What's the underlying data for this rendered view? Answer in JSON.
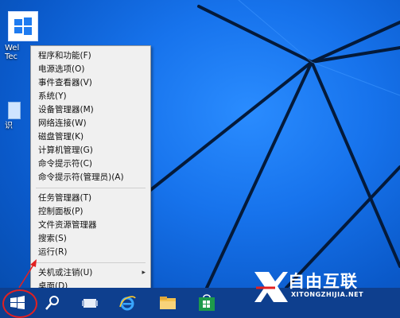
{
  "desktop": {
    "icons": [
      {
        "label": "Wel\nTec",
        "name": "welcome-tech-icon"
      },
      {
        "label": "识",
        "name": "recycle-or-app-icon"
      }
    ]
  },
  "context_menu": {
    "groups": [
      [
        "程序和功能(F)",
        "电源选项(O)",
        "事件查看器(V)",
        "系统(Y)",
        "设备管理器(M)",
        "网络连接(W)",
        "磁盘管理(K)",
        "计算机管理(G)",
        "命令提示符(C)",
        "命令提示符(管理员)(A)"
      ],
      [
        "任务管理器(T)",
        "控制面板(P)",
        "文件资源管理器",
        "搜索(S)",
        "运行(R)"
      ],
      [
        "关机或注销(U)",
        "桌面(D)"
      ]
    ],
    "submenu_arrow": "▸"
  },
  "taskbar": {
    "buttons": [
      "start-icon",
      "search-icon",
      "task-view-icon",
      "ie-icon",
      "file-explorer-icon",
      "store-icon"
    ]
  },
  "watermark": {
    "main": "自由互联",
    "sub": "XITONGZHIJIA.NET"
  },
  "colors": {
    "desktop": "#0b63d3",
    "taskbar": "#0e3f8e",
    "menu_bg": "#f0f0f0",
    "annotation": "#e32020"
  }
}
